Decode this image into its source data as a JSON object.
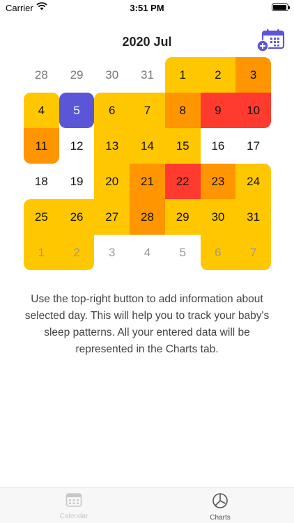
{
  "status_bar": {
    "carrier": "Carrier",
    "time": "3:51 PM"
  },
  "header": {
    "title": "2020 Jul",
    "add_button_icon": "calendar-add-icon"
  },
  "calendar": {
    "days": [
      {
        "label": "28",
        "level": "none",
        "muted": "gray"
      },
      {
        "label": "29",
        "level": "none",
        "muted": "gray"
      },
      {
        "label": "30",
        "level": "none",
        "muted": "gray"
      },
      {
        "label": "31",
        "level": "none",
        "muted": "gray"
      },
      {
        "label": "1",
        "level": "yellow"
      },
      {
        "label": "2",
        "level": "yellow"
      },
      {
        "label": "3",
        "level": "orange"
      },
      {
        "label": "4",
        "level": "yellow"
      },
      {
        "label": "5",
        "level": "selected"
      },
      {
        "label": "6",
        "level": "yellow"
      },
      {
        "label": "7",
        "level": "yellow"
      },
      {
        "label": "8",
        "level": "orange"
      },
      {
        "label": "9",
        "level": "red"
      },
      {
        "label": "10",
        "level": "red"
      },
      {
        "label": "11",
        "level": "orange"
      },
      {
        "label": "12",
        "level": "none"
      },
      {
        "label": "13",
        "level": "yellow"
      },
      {
        "label": "14",
        "level": "yellow"
      },
      {
        "label": "15",
        "level": "yellow"
      },
      {
        "label": "16",
        "level": "none"
      },
      {
        "label": "17",
        "level": "none"
      },
      {
        "label": "18",
        "level": "none"
      },
      {
        "label": "19",
        "level": "none"
      },
      {
        "label": "20",
        "level": "yellow"
      },
      {
        "label": "21",
        "level": "orange"
      },
      {
        "label": "22",
        "level": "red"
      },
      {
        "label": "23",
        "level": "orange"
      },
      {
        "label": "24",
        "level": "yellow"
      },
      {
        "label": "25",
        "level": "yellow"
      },
      {
        "label": "26",
        "level": "yellow"
      },
      {
        "label": "27",
        "level": "yellow"
      },
      {
        "label": "28",
        "level": "orange"
      },
      {
        "label": "29",
        "level": "yellow"
      },
      {
        "label": "30",
        "level": "yellow"
      },
      {
        "label": "31",
        "level": "yellow"
      },
      {
        "label": "1",
        "level": "yellow",
        "muted": "faded"
      },
      {
        "label": "2",
        "level": "yellow",
        "muted": "faded"
      },
      {
        "label": "3",
        "level": "none",
        "muted": "faded"
      },
      {
        "label": "4",
        "level": "none",
        "muted": "faded"
      },
      {
        "label": "5",
        "level": "none",
        "muted": "faded"
      },
      {
        "label": "6",
        "level": "yellow",
        "muted": "faded"
      },
      {
        "label": "7",
        "level": "yellow",
        "muted": "faded"
      }
    ],
    "colors": {
      "yellow": "#ffc700",
      "orange": "#ff9500",
      "red": "#ff3b30",
      "selected": "#5b55d8"
    }
  },
  "message": "Use the top-right button to add information about selected day. This will help you to track your baby's sleep patterns. All your entered data will be represented in the Charts tab.",
  "tabs": [
    {
      "label": "Calendar",
      "icon": "calendar-icon",
      "active": false
    },
    {
      "label": "Charts",
      "icon": "pie-chart-icon",
      "active": true
    }
  ]
}
